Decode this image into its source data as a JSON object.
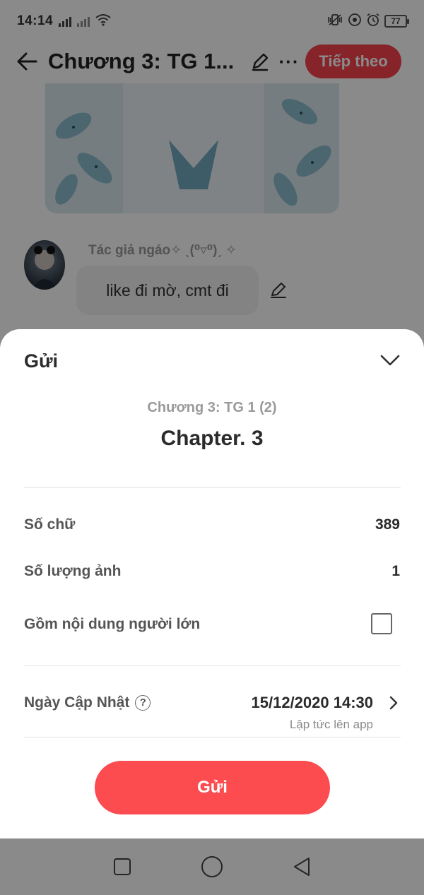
{
  "status_bar": {
    "time": "14:14",
    "battery": "77"
  },
  "header": {
    "title": "Chương 3: TG 1...",
    "next_label": "Tiếp theo"
  },
  "comment": {
    "author": "Tác giả ngáo✧ ˎ(⁰▿⁰)ˏ ✧",
    "text": "like đi mờ, cmt đi"
  },
  "sheet": {
    "title": "Gửi",
    "chapter_subtitle": "Chương 3: TG 1 (2)",
    "chapter_heading": "Chapter. 3",
    "rows": {
      "word_count_label": "Số chữ",
      "word_count_value": "389",
      "image_count_label": "Số lượng ảnh",
      "image_count_value": "1",
      "adult_label": "Gồm nội dung người lớn",
      "adult_checked": false
    },
    "update": {
      "label": "Ngày Cập Nhật",
      "date": "15/12/2020 14:30",
      "note": "Lập tức lên app"
    },
    "send_label": "Gửi"
  },
  "colors": {
    "accent": "#fd4c50",
    "next_button": "#f7434d",
    "overlay": "rgba(0,0,0,0.46)"
  }
}
